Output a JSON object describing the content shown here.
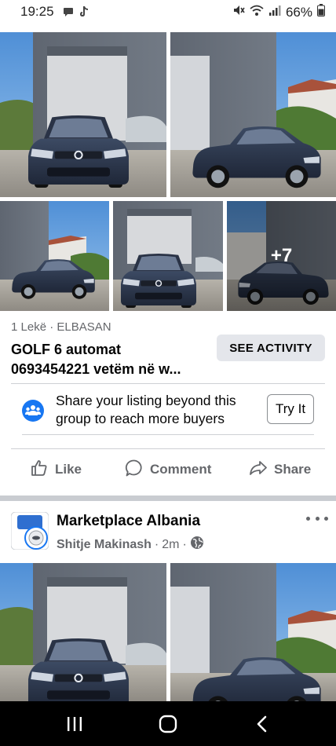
{
  "status_bar": {
    "time": "19:25",
    "battery": "66%"
  },
  "listing": {
    "photos_more": "+7",
    "price_location": "1 Lekë · ELBASAN",
    "title_line1": "GOLF 6 automat",
    "title_line2": "0693454221 vetëm në w...",
    "see_activity_label": "SEE ACTIVITY"
  },
  "promo": {
    "line1": "Share your listing beyond this",
    "line2": "group to reach more buyers",
    "button_label": "Try It"
  },
  "actions": {
    "like": "Like",
    "comment": "Comment",
    "share": "Share"
  },
  "next_post": {
    "group_name": "Marketplace Albania",
    "author": "Shitje Makinash",
    "time": "2m"
  },
  "colors": {
    "accent": "#1877f2",
    "muted_text": "#65676b",
    "button_bg": "#e4e6eb"
  }
}
